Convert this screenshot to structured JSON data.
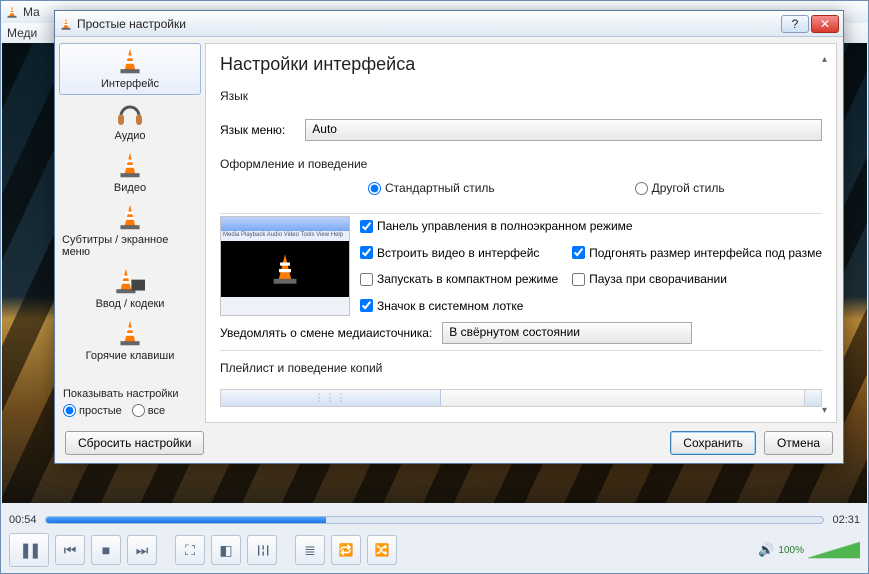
{
  "main": {
    "title_prefix": "Ma",
    "menu_prefix": "Меди",
    "time_elapsed": "00:54",
    "time_total": "02:31",
    "volume_pct": "100%"
  },
  "dialog": {
    "title": "Простые настройки",
    "categories": [
      {
        "label": "Интерфейс",
        "selected": true
      },
      {
        "label": "Аудио"
      },
      {
        "label": "Видео"
      },
      {
        "label": "Субтитры / экранное меню"
      },
      {
        "label": "Ввод / кодеки"
      },
      {
        "label": "Горячие клавиши"
      }
    ],
    "show_settings": {
      "title": "Показывать настройки",
      "simple": "простые",
      "all": "все"
    },
    "heading": "Настройки интерфейса",
    "lang_section": "Язык",
    "lang_label": "Язык меню:",
    "lang_value": "Auto",
    "look_section": "Оформление и поведение",
    "style_native": "Стандартный стиль",
    "style_skin": "Другой стиль",
    "cb_fs_ctrl": "Панель управления в полноэкранном режиме",
    "cb_embed": "Встроить видео в интерфейс",
    "cb_resize": "Подгонять размер интерфейса под разме",
    "cb_minimal": "Запускать в компактном режиме",
    "cb_pause_min": "Пауза при сворачивании",
    "cb_systray": "Значок в системном лотке",
    "notify_label": "Уведомлять о смене медиаисточника:",
    "notify_value": "В свёрнутом состоянии",
    "playlist_section": "Плейлист и поведение копий",
    "btn_reset": "Сбросить настройки",
    "btn_save": "Сохранить",
    "btn_cancel": "Отмена"
  }
}
